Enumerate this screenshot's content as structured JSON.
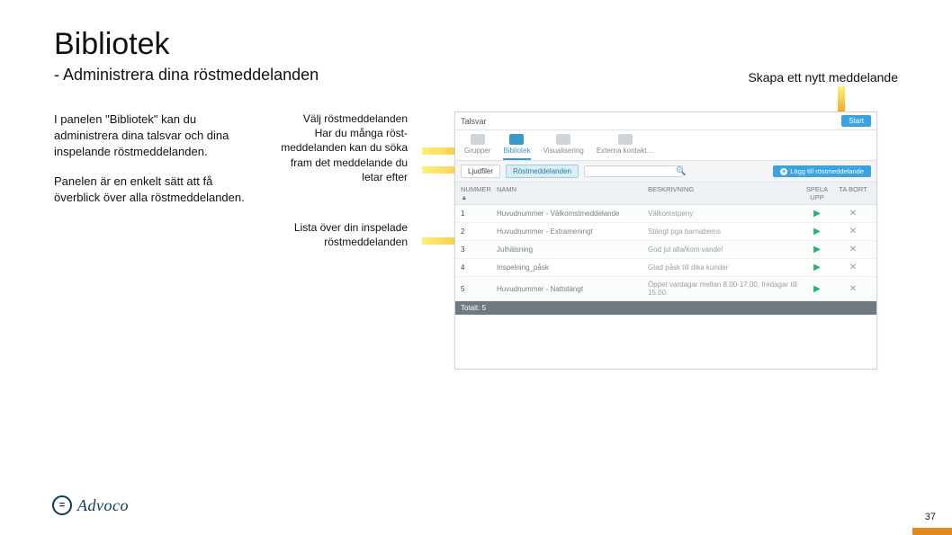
{
  "title": "Bibliotek",
  "subtitle": "- Administrera dina röstmeddelanden",
  "top_link": "Skapa ett nytt meddelande",
  "left_paragraph_1": "I panelen \"Bibliotek\" kan du administrera dina talsvar och dina inspelande röstmeddelanden.",
  "left_paragraph_2": "Panelen är en enkelt sätt att få överblick över alla röstmeddelanden.",
  "callout_1_line1": "Välj röstmeddelanden",
  "callout_1_line2": "Har du många röst-meddelanden kan du söka fram det meddelande du letar efter",
  "callout_2": "Lista över din inspelade röstmeddelanden",
  "app": {
    "top_title": "Talsvar",
    "start_btn": "Start",
    "tabs": [
      {
        "label": "Grupper",
        "active": false
      },
      {
        "label": "Bibliotek",
        "active": true
      },
      {
        "label": "Visualisering",
        "active": false
      },
      {
        "label": "Externa kontakt…",
        "active": false
      }
    ],
    "chip_off": "Ljudfiler",
    "chip_on": "Röstmeddelanden",
    "search_placeholder": "",
    "add_btn": "Lägg till röstmeddelande",
    "columns": {
      "num": "NUMMER ▲",
      "name": "NAMN",
      "desc": "BESKRIVNING",
      "play": "SPELA UPP",
      "del": "TA BORT"
    },
    "rows": [
      {
        "num": "1",
        "name": "Huvudnummer - Välkomstmeddelande",
        "desc": "Välkomstpeny"
      },
      {
        "num": "2",
        "name": "Huvudnummer - Extrameningt",
        "desc": "Stängt pga barnabems"
      },
      {
        "num": "3",
        "name": "Julhälsning",
        "desc": "God jul alla/kom vande!"
      },
      {
        "num": "4",
        "name": "Inspelning_påsk",
        "desc": "Glad påsk till dika kunder"
      },
      {
        "num": "5",
        "name": "Huvudnummer - Nattstängt",
        "desc": "Öppet vardagar mellan 8.00-17.00, fredagar till 15.00."
      }
    ],
    "total_label": "Totalt: 5"
  },
  "logo_text": "Advoco",
  "page_number": "37"
}
